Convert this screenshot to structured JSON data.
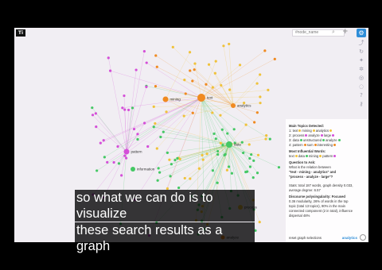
{
  "search": {
    "placeholder": "#node_name"
  },
  "top_icons": [
    "search-icon",
    "add-icon",
    "settings-icon"
  ],
  "logo": "Ti",
  "side_icons": [
    "share-icon",
    "refresh-icon",
    "bulb-icon",
    "settings-icon",
    "info-icon",
    "chat-icon",
    "help-icon",
    "key-icon"
  ],
  "panel": {
    "main_topics_heading": "Main Topics Detected:",
    "topics": [
      {
        "label": "1:",
        "words": [
          "text",
          "mining",
          "analytics"
        ],
        "color": "#f0c23a"
      },
      {
        "label": "2:",
        "words": [
          "process",
          "analyze",
          "large"
        ],
        "color": "#d44fd8"
      },
      {
        "label": "3:",
        "words": [
          "data",
          "unstructured",
          "analyze"
        ],
        "color": "#44c864"
      },
      {
        "label": "4:",
        "words": [
          "pattern",
          "sum",
          "interesting"
        ],
        "color": "#f08a20"
      }
    ],
    "influential_heading": "Most Influential Words:",
    "influential": [
      "text",
      "data",
      "mining",
      "pattern"
    ],
    "question_heading": "Question to Ask:",
    "question_lines": [
      "What is the relation between",
      "\"text - mining - analytics\" and",
      "\"process - analyze - large\"?"
    ],
    "stats_lines": [
      "Stats: total 187 words, graph density 0.033,",
      "average degree: 6.57"
    ],
    "polarity_heading": "Discourse polysingularity: Focused",
    "polarity_lines": [
      "0.36 modularity, 26% of words in the top",
      "topic (total 13 topics), 90% in the main",
      "connected component (2 in total), influence",
      "dispersal 48%"
    ],
    "reset_link": "reset graph selections",
    "analytics_btn": "analytics"
  },
  "node_labels": [
    "text",
    "mining",
    "analytics",
    "data",
    "pattern",
    "information",
    "process",
    "analyze"
  ],
  "colors": {
    "gold": "#f0c23a",
    "orange": "#f08a20",
    "green": "#44c864",
    "magenta": "#d44fd8",
    "accent": "#2f8ed8"
  },
  "subtitle": {
    "line1": "so what we can do is to visualize",
    "line2": "these search results as a graph"
  }
}
